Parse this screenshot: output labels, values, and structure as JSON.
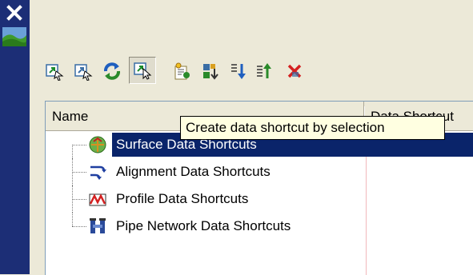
{
  "palette": {
    "close_icon": "close-icon",
    "strip_icon": "landscape-icon"
  },
  "toolbar": {
    "buttons": [
      {
        "name": "create-data-shortcut-button",
        "icon": "shortcut-icon"
      },
      {
        "name": "edit-data-shortcut-button",
        "icon": "shortcut-icon"
      },
      {
        "name": "refresh-button",
        "icon": "refresh-icon"
      },
      {
        "name": "create-shortcut-by-selection-button",
        "icon": "select-shortcut-icon",
        "pressed": true
      },
      {
        "name": "properties-button",
        "icon": "properties-icon"
      },
      {
        "name": "sort-button",
        "icon": "sort-icon"
      },
      {
        "name": "move-down-button",
        "icon": "arrow-down-icon"
      },
      {
        "name": "move-up-button",
        "icon": "arrow-up-icon"
      },
      {
        "name": "delete-button",
        "icon": "delete-icon"
      }
    ]
  },
  "columns": {
    "name": "Name",
    "data_shortcut": "Data Shortcut"
  },
  "tree": [
    {
      "label": "Surface Data Shortcuts",
      "icon": "surface-icon",
      "selected": true
    },
    {
      "label": "Alignment Data Shortcuts",
      "icon": "alignment-icon",
      "selected": false
    },
    {
      "label": "Profile Data Shortcuts",
      "icon": "profile-icon",
      "selected": false
    },
    {
      "label": "Pipe Network Data Shortcuts",
      "icon": "pipe-network-icon",
      "selected": false
    }
  ],
  "tooltip": "Create data shortcut by selection",
  "colors": {
    "selection": "#0a246a",
    "title_strip": "#1c2e76",
    "delete_red": "#d42020"
  }
}
